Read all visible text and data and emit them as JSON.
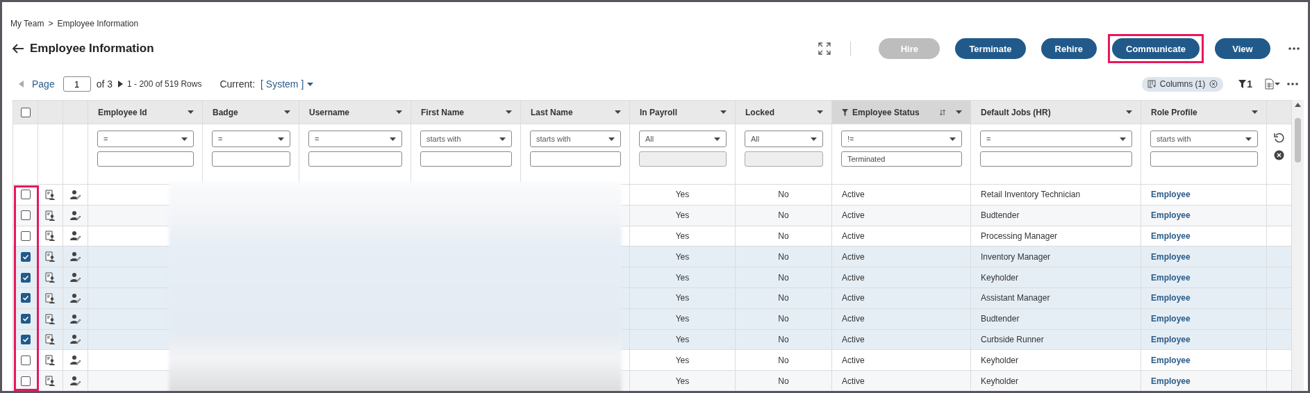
{
  "breadcrumb": [
    {
      "label": "My Team"
    },
    {
      "label": ">"
    },
    {
      "label": "Employee Information"
    }
  ],
  "page_title": "Employee Information",
  "header_buttons": [
    {
      "label": "Hire",
      "disabled": true,
      "highlighted": false
    },
    {
      "label": "Terminate",
      "disabled": false,
      "highlighted": false
    },
    {
      "label": "Rehire",
      "disabled": false,
      "highlighted": false
    },
    {
      "label": "Communicate",
      "disabled": false,
      "highlighted": true
    },
    {
      "label": "View",
      "disabled": false,
      "highlighted": false
    }
  ],
  "pager": {
    "page_label": "Page",
    "page_value": "1",
    "of_text": "of 3",
    "rows_text": "1 - 200 of 519 Rows",
    "current_label": "Current:",
    "current_view": "[ System ]"
  },
  "toolbar": {
    "columns_chip": "Columns (1)",
    "filter_count": "1"
  },
  "table": {
    "select_all_checked": false,
    "checkbox_column_highlighted": true,
    "columns": [
      {
        "label": "Employee Id",
        "filter_operator": "=",
        "filter_disabled": false,
        "filtered": false,
        "sorted": false
      },
      {
        "label": "Badge",
        "filter_operator": "=",
        "filter_disabled": false,
        "filtered": false,
        "sorted": false
      },
      {
        "label": "Username",
        "filter_operator": "=",
        "filter_disabled": false,
        "filtered": false,
        "sorted": false
      },
      {
        "label": "First Name",
        "filter_operator": "starts with",
        "filter_disabled": false,
        "filtered": false,
        "sorted": false
      },
      {
        "label": "Last Name",
        "filter_operator": "starts with",
        "filter_disabled": false,
        "filtered": false,
        "sorted": false
      },
      {
        "label": "In Payroll",
        "filter_operator": "All",
        "filter_disabled": true,
        "filtered": false,
        "sorted": false
      },
      {
        "label": "Locked",
        "filter_operator": "All",
        "filter_disabled": true,
        "filtered": false,
        "sorted": false
      },
      {
        "label": "Employee Status",
        "filter_operator": "!=",
        "filter_value": "Terminated",
        "filter_disabled": false,
        "filtered": true,
        "sorted": true
      },
      {
        "label": "Default Jobs (HR)",
        "filter_operator": "=",
        "filter_disabled": false,
        "filtered": false,
        "sorted": false
      },
      {
        "label": "Role Profile",
        "filter_operator": "starts with",
        "filter_disabled": false,
        "filtered": false,
        "sorted": false
      }
    ],
    "rows": [
      {
        "selected": false,
        "in_payroll": "Yes",
        "locked": "No",
        "status": "Active",
        "job": "Retail Inventory Technician",
        "role": "Employee"
      },
      {
        "selected": false,
        "in_payroll": "Yes",
        "locked": "No",
        "status": "Active",
        "job": "Budtender",
        "role": "Employee"
      },
      {
        "selected": false,
        "in_payroll": "Yes",
        "locked": "No",
        "status": "Active",
        "job": "Processing Manager",
        "role": "Employee"
      },
      {
        "selected": true,
        "in_payroll": "Yes",
        "locked": "No",
        "status": "Active",
        "job": "Inventory Manager",
        "role": "Employee"
      },
      {
        "selected": true,
        "in_payroll": "Yes",
        "locked": "No",
        "status": "Active",
        "job": "Keyholder",
        "role": "Employee"
      },
      {
        "selected": true,
        "in_payroll": "Yes",
        "locked": "No",
        "status": "Active",
        "job": "Assistant Manager",
        "role": "Employee"
      },
      {
        "selected": true,
        "in_payroll": "Yes",
        "locked": "No",
        "status": "Active",
        "job": "Budtender",
        "role": "Employee"
      },
      {
        "selected": true,
        "in_payroll": "Yes",
        "locked": "No",
        "status": "Active",
        "job": "Curbside Runner",
        "role": "Employee"
      },
      {
        "selected": false,
        "in_payroll": "Yes",
        "locked": "No",
        "status": "Active",
        "job": "Keyholder",
        "role": "Employee"
      },
      {
        "selected": false,
        "in_payroll": "Yes",
        "locked": "No",
        "status": "Active",
        "job": "Keyholder",
        "role": "Employee"
      }
    ]
  }
}
